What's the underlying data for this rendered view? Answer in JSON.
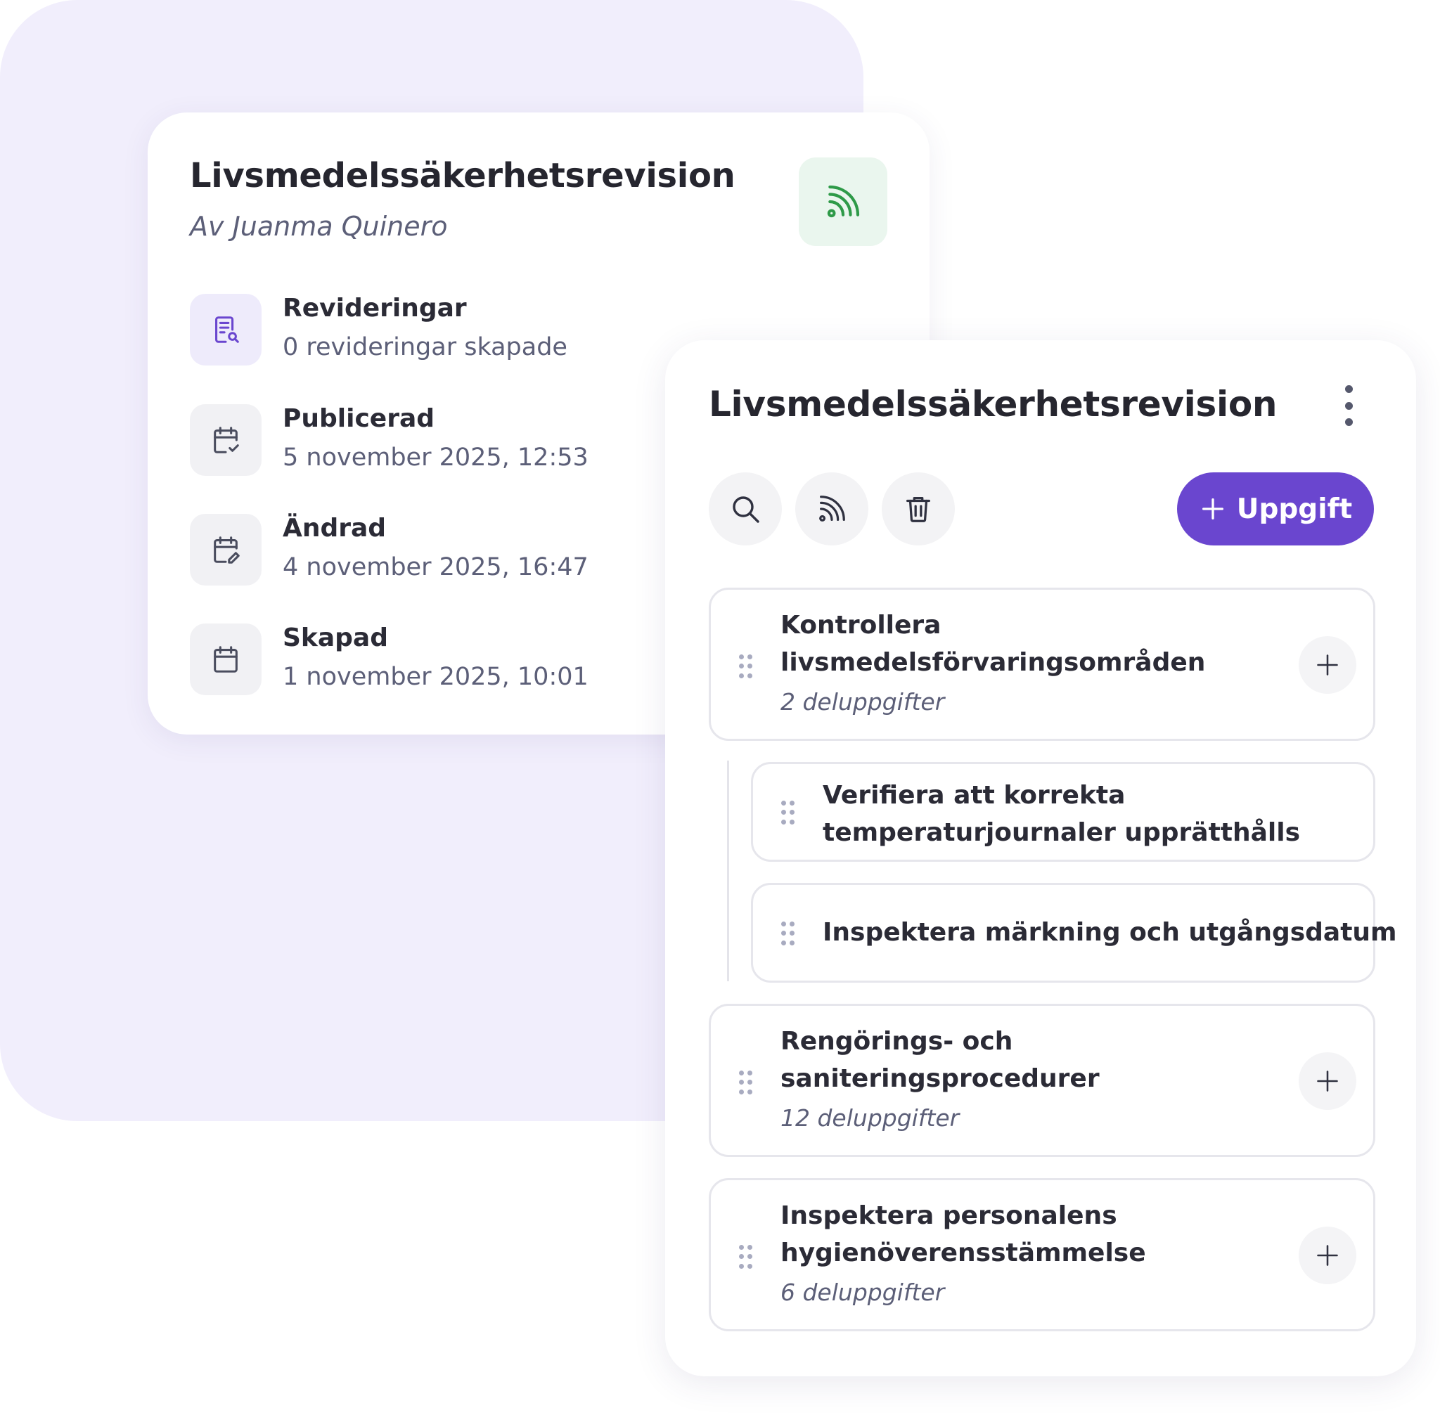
{
  "info_card": {
    "title": "Livsmedelssäkerhetsrevision",
    "author": "Av Juanma Quinero",
    "status_icon": "rss-icon",
    "status_color": "#2e9a48",
    "meta": [
      {
        "label": "Revideringar",
        "value": "0 revideringar skapade",
        "icon": "document-search-icon"
      },
      {
        "label": "Publicerad",
        "value": "5 november 2025, 12:53",
        "icon": "calendar-check-icon"
      },
      {
        "label": "Ändrad",
        "value": "4 november 2025, 16:47",
        "icon": "calendar-edit-icon"
      },
      {
        "label": "Skapad",
        "value": "1 november 2025, 10:01",
        "icon": "calendar-icon"
      }
    ]
  },
  "task_card": {
    "title": "Livsmedelssäkerhetsrevision",
    "toolbar": {
      "icons": [
        "search-icon",
        "rss-icon",
        "trash-icon"
      ],
      "add_label": "Uppgift",
      "accent": "#6a46cf"
    },
    "tasks": [
      {
        "title_line1": "Kontrollera",
        "title_line2": "livsmedelsförvaringsområden",
        "subtasks": "2 deluppgifter"
      },
      {
        "title_line1": "Verifiera att korrekta",
        "title_line2": "temperaturjournaler upprätthålls"
      },
      {
        "title": "Inspektera märkning och utgångsdatum"
      },
      {
        "title_line1": "Rengörings- och",
        "title_line2": "saniteringsprocedurer",
        "subtasks": "12 deluppgifter"
      },
      {
        "title_line1": "Inspektera personalens",
        "title_line2": "hygienöverensstämmelse",
        "subtasks": "6 deluppgifter"
      }
    ]
  }
}
